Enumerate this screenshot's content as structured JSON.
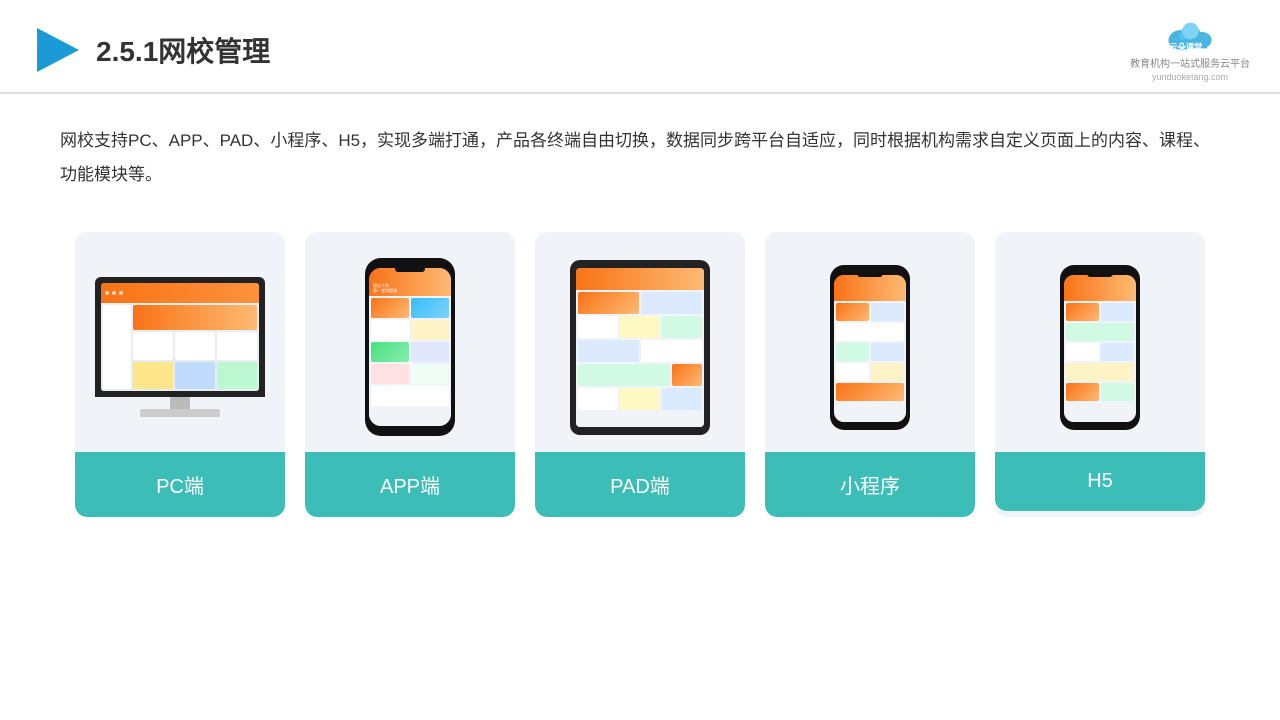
{
  "header": {
    "title": "2.5.1网校管理",
    "logo_name": "云朵课堂",
    "logo_url": "yunduoketang.com",
    "logo_tagline": "教育机构一站式服务云平台"
  },
  "description": {
    "text": "网校支持PC、APP、PAD、小程序、H5，实现多端打通，产品各终端自由切换，数据同步跨平台自适应，同时根据机构需求自定义页面上的内容、课程、功能模块等。"
  },
  "cards": [
    {
      "id": "pc",
      "label": "PC端"
    },
    {
      "id": "app",
      "label": "APP端"
    },
    {
      "id": "pad",
      "label": "PAD端"
    },
    {
      "id": "miniapp",
      "label": "小程序"
    },
    {
      "id": "h5",
      "label": "H5"
    }
  ],
  "colors": {
    "teal": "#3dbdb8",
    "accent_blue": "#1a9bd7",
    "text_dark": "#333333"
  }
}
